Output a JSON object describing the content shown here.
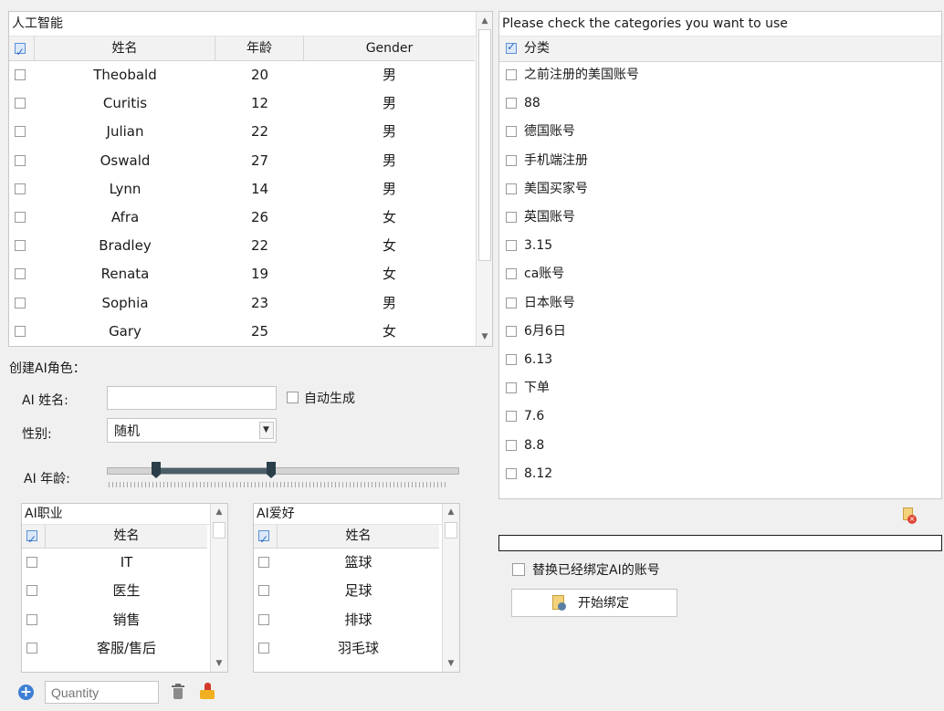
{
  "top_grid": {
    "caption": "人工智能",
    "columns": [
      "姓名",
      "年龄",
      "Gender"
    ],
    "rows": [
      {
        "name": "Theobald",
        "age": "20",
        "gender": "男"
      },
      {
        "name": "Curitis",
        "age": "12",
        "gender": "男"
      },
      {
        "name": "Julian",
        "age": "22",
        "gender": "男"
      },
      {
        "name": "Oswald",
        "age": "27",
        "gender": "男"
      },
      {
        "name": "Lynn",
        "age": "14",
        "gender": "男"
      },
      {
        "name": "Afra",
        "age": "26",
        "gender": "女"
      },
      {
        "name": "Bradley",
        "age": "22",
        "gender": "女"
      },
      {
        "name": "Renata",
        "age": "19",
        "gender": "女"
      },
      {
        "name": "Sophia",
        "age": "23",
        "gender": "男"
      },
      {
        "name": "Gary",
        "age": "25",
        "gender": "女"
      }
    ]
  },
  "create_form": {
    "title": "创建AI角色：",
    "name_label": "AI 姓名:",
    "name_value": "",
    "auto_label": "自动生成",
    "gender_label": "性别:",
    "gender_value": "随机",
    "age_label": "AI 年龄:"
  },
  "job_grid": {
    "caption": "AI职业",
    "column": "姓名",
    "rows": [
      "IT",
      "医生",
      "销售",
      "客服/售后"
    ]
  },
  "hobby_grid": {
    "caption": "AI爱好",
    "column": "姓名",
    "rows": [
      "篮球",
      "足球",
      "排球",
      "羽毛球"
    ]
  },
  "bottom_bar": {
    "quantity_placeholder": "Quantity",
    "icons": [
      "add-circle-icon",
      "trash-icon",
      "broom-icon"
    ]
  },
  "categories": {
    "caption": "Please check the categories you want to use",
    "header": "分类",
    "items": [
      "之前注册的美国账号",
      "88",
      "德国账号",
      "手机端注册",
      "美国买家号",
      "英国账号",
      "3.15",
      "ca账号",
      "日本账号",
      "6月6日",
      "6.13",
      "下单",
      "7.6",
      "8.8",
      "8.12"
    ]
  },
  "bind": {
    "replace_label": "替换已经绑定AI的账号",
    "start_button": "开始绑定"
  },
  "colors": {
    "accent": "#2f6bc4",
    "slider_track": "#4a5f68",
    "slider_thumb": "#2a3f4a"
  }
}
